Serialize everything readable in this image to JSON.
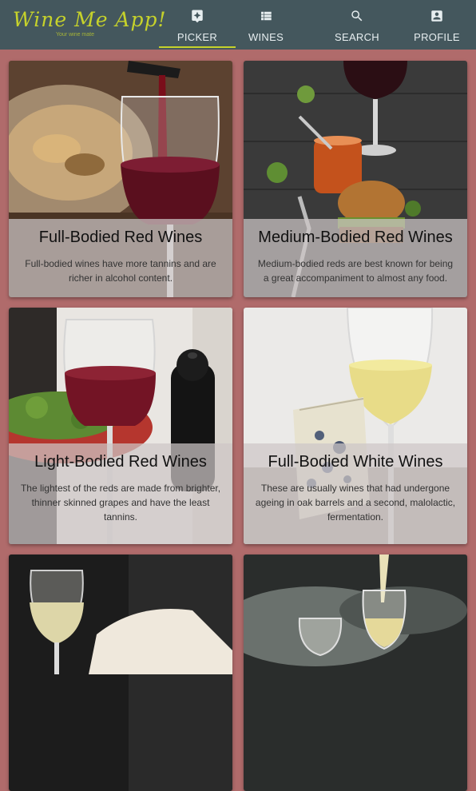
{
  "app": {
    "logo_text": "Wine Me App!",
    "tagline": "Your wine mate"
  },
  "nav": {
    "tabs": [
      {
        "label": "PICKER",
        "icon": "pin-star-icon",
        "active": true
      },
      {
        "label": "WINES",
        "icon": "list-icon",
        "active": false
      },
      {
        "label": "SEARCH",
        "icon": "search-icon",
        "active": false
      },
      {
        "label": "PROFILE",
        "icon": "account-box-icon",
        "active": false
      }
    ]
  },
  "cards": [
    {
      "title": "Full-Bodied Red Wines",
      "description": "Full-bodied wines have more tannins and are richer in alcohol content.",
      "image": "red wine being poured into glass beside roasted food"
    },
    {
      "title": "Medium-Bodied Red Wines",
      "description": "Medium-bodied reds are best known for being a great accompaniment to almost any food.",
      "image": "wine glass with burger and tomato sauce on dark wood"
    },
    {
      "title": "Light-Bodied Red Wines",
      "description": "The lightest of the reds are made from brighter, thinner skinned grapes and have the least tannins.",
      "image": "red wine glass with salad plate and pepper mill"
    },
    {
      "title": "Full-Bodied White Wines",
      "description": "These are usually wines that had undergone ageing in oak barrels and a second, malolactic, fermentation.",
      "image": "white wine glass with blue cheese"
    },
    {
      "title": "",
      "description": "",
      "image": "white wine glass on dark table"
    },
    {
      "title": "",
      "description": "",
      "image": "white wine being poured into glasses"
    }
  ],
  "colors": {
    "background": "#b06b6b",
    "topbar": "#44575d",
    "accent": "#c6d22b"
  }
}
